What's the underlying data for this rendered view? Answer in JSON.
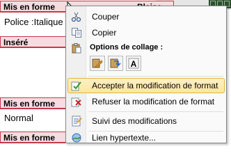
{
  "document": {
    "balloon_1_label": "Mis en forme",
    "balloon_1_right": "Blaise",
    "line_1_text": "Police :Italique",
    "balloon_2_label": "Inséré",
    "balloon_3_label": "Mis en forme",
    "line_2_text": "Normal",
    "balloon_4_label": "Mis en forme"
  },
  "menu": {
    "cut_label": "Couper",
    "copy_label": "Copier",
    "paste_options_label": "Options de collage :",
    "accept_label": "Accepter la modification de format",
    "reject_label": "Refuser la modification de format",
    "track_label": "Suivi des modifications",
    "hyperlink_label": "Lien hypertexte...",
    "paste_buttons": [
      "keep-source-formatting",
      "merge-formatting",
      "keep-text-only"
    ],
    "paste_text_only_glyph": "A"
  },
  "colors": {
    "balloon_fill": "#f6dbe0",
    "balloon_border": "#c43a4a",
    "highlight_top": "#fef0c5",
    "highlight_bottom": "#fde6a0",
    "highlight_border": "#e4b43a"
  }
}
